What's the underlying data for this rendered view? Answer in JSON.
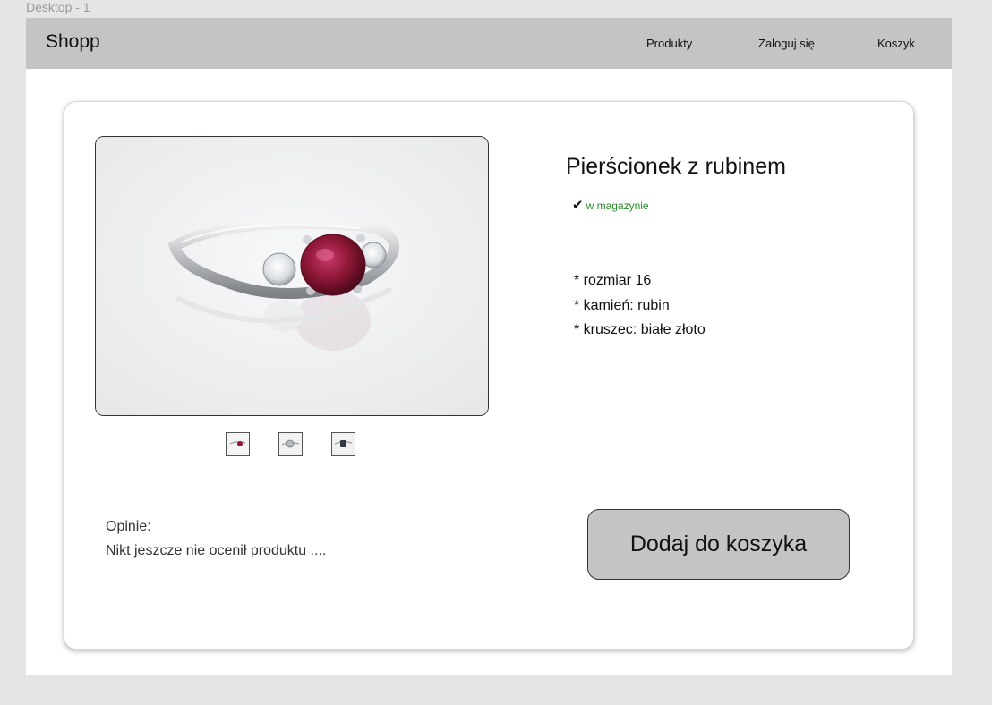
{
  "frame": {
    "label": "Desktop - 1"
  },
  "navbar": {
    "brand": "Shopp",
    "links": [
      "Produkty",
      "Zaloguj się",
      "Koszyk"
    ]
  },
  "product": {
    "title": "Pierścionek z rubinem",
    "stock_icon": "checkmark-icon",
    "stock_status": "w magazynie",
    "stock_color": "#2a8a2a",
    "features": [
      "* rozmiar 16",
      "* kamień: rubin",
      "* kruszec: białe złoto"
    ],
    "images": [
      "ring-ruby-photo",
      "ring-diamond-photo",
      "ring-sapphire-photo"
    ],
    "add_to_cart_label": "Dodaj do koszyka"
  },
  "reviews": {
    "label": "Opinie:",
    "empty_text": "Nikt jeszcze nie ocenił produktu ...."
  },
  "colors": {
    "navbar_bg": "#c4c4c4",
    "button_bg": "#c4c4c4",
    "ruby": "#8b1a3c"
  }
}
